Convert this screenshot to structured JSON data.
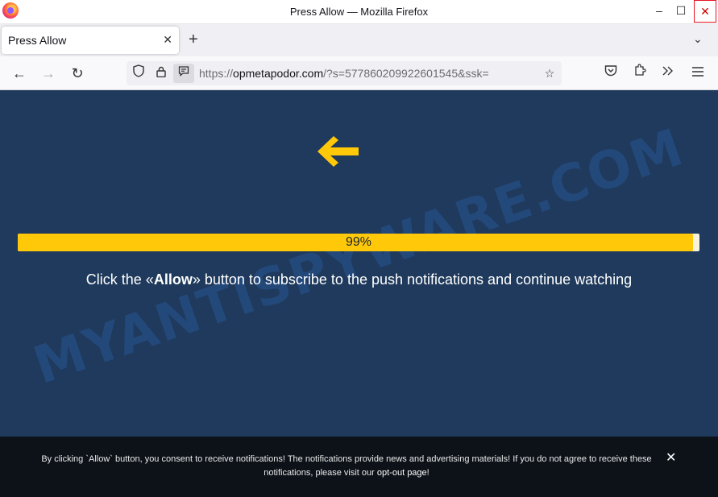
{
  "window": {
    "title": "Press Allow — Mozilla Firefox",
    "minimize_icon": "–",
    "maximize_icon": "☐",
    "close_icon": "✕"
  },
  "tabs": [
    {
      "label": "Press Allow",
      "close_icon": "✕"
    }
  ],
  "tabstrip": {
    "new_tab_icon": "+",
    "list_all_tabs_icon": "⌄"
  },
  "navbar": {
    "back_icon": "←",
    "forward_icon": "→",
    "reload_icon": "↻",
    "url_prefix": "https://",
    "url_domain": "opmetapodor.com",
    "url_rest": "/?s=577860209922601545&ssk=",
    "bookmark_icon": "☆"
  },
  "page": {
    "progress_percent": 99,
    "progress_label": "99%",
    "instruction_before": "Click the «",
    "instruction_bold": "Allow",
    "instruction_after": "» button to subscribe to the push notifications and continue watching",
    "watermark": "MYANTISPYWARE.COM",
    "accent_color": "#ffc90a",
    "background_color": "#1f3a5c"
  },
  "consent": {
    "text": "By clicking `Allow` button, you consent to receive notifications! The notifications provide news and advertising materials! If you do not agree to receive these notifications, please visit our ",
    "link_text": "opt-out page",
    "suffix": "!",
    "close_icon": "✕"
  }
}
